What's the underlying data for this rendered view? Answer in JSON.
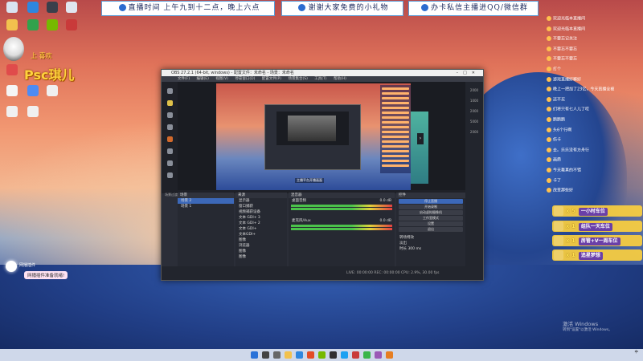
{
  "banners": [
    "直播时间 上午九到十二点，晚上六点",
    "谢谢大家免费的小礼物",
    "办卡私信主播进QQ/微信群"
  ],
  "streamer": {
    "sub": "上 喜欢",
    "name": "Psc琪儿"
  },
  "obs": {
    "title": "OBS 27.2.1 (64-bit, windows) - 配置文件：未命名 - 场景：未命名",
    "menu": [
      "文件(F)",
      "编辑(E)",
      "视图(V)",
      "停靠窗口(D)",
      "配置文件(P)",
      "场景集合(S)",
      "工具(T)",
      "帮助(H)"
    ],
    "canvas_label": "主播平台开播画面",
    "scene_header": "场景",
    "sources_header": "来源",
    "mixer_header": "混音器",
    "controls_header": "控件",
    "scenes": [
      "场景 2",
      "场景 1"
    ],
    "sources": [
      "显示器",
      "窗口捕获",
      "视频捕获设备",
      "文本 GDI+ 3",
      "文本 GDI+ 2",
      "文本 GDI+",
      "文本GDI+",
      "图像",
      "浏览器",
      "图像",
      "图像"
    ],
    "mixer": [
      {
        "name": "桌面音频",
        "level": "0.0 dB"
      },
      {
        "name": "麦克风/Aux",
        "level": "0.0 dB"
      }
    ],
    "controls": [
      "停止直播",
      "开始录制",
      "启动虚拟摄像机",
      "工作室模式",
      "设置",
      "退出"
    ],
    "transition": {
      "label": "转场特效",
      "value": "淡出",
      "duration_label": "时长",
      "duration": "300 ms"
    },
    "status": "LIVE: 00:00:00   REC: 00:00:00   CPU: 2.9%, 30.00 fps",
    "rightbar": [
      "2000",
      "1000",
      "2000",
      "5000",
      "2000"
    ],
    "scene_toolbar": "场景过渡"
  },
  "chat": [
    {
      "user": "",
      "text": "欢迎光临本直播间"
    },
    {
      "user": "",
      "text": "欢迎光临本直播间"
    },
    {
      "user": "",
      "text": "不要忘记关注"
    },
    {
      "user": "",
      "text": "不要忘不要忘"
    },
    {
      "user": "",
      "text": "不要忘不要忘"
    },
    {
      "user": "",
      "text": "打个"
    },
    {
      "user": "",
      "text": "游戏直播好嘛好"
    },
    {
      "user": "",
      "text": "晚上一把加了23亿，今天直播全被"
    },
    {
      "user": "",
      "text": "还不买"
    },
    {
      "user": "",
      "text": "们将只有七人儿了哎"
    },
    {
      "user": "",
      "text": "鹅鹅鹅"
    },
    {
      "user": "",
      "text": "头6个行啊"
    },
    {
      "user": "",
      "text": "伤卡"
    },
    {
      "user": "",
      "text": "去。乐乐没有方舟行"
    },
    {
      "user": "",
      "text": "画质"
    },
    {
      "user": "",
      "text": "今天舞真的不错"
    },
    {
      "user": "",
      "text": "卡了"
    },
    {
      "user": "",
      "text": "改变那些好"
    }
  ],
  "gifts": [
    {
      "count": "x 5",
      "name": "一小时车位"
    },
    {
      "count": "x 1",
      "name": "组队一天车位"
    },
    {
      "count": "x 1",
      "name": "房管+V一周车位"
    },
    {
      "count": "x 1",
      "name": "追星梦想"
    }
  ],
  "plugin": {
    "name": "网播插件",
    "message": "网播插件准备就绪!"
  },
  "watermark": {
    "title": "激活 Windows",
    "sub": "转到\"设置\"以激活 Windows。"
  },
  "tray": {
    "line1": "中",
    "line2": ""
  },
  "colors": {
    "banner_border": "#5b9bd5",
    "obs_bg": "#2b2e38",
    "gift_gold": "#ffd23c",
    "streamer_name": "#ffd23c"
  }
}
